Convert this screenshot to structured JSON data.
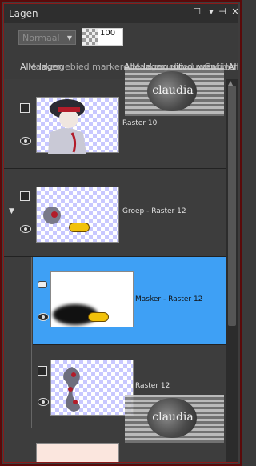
{
  "panel": {
    "title": "Lagen",
    "window_icons": [
      "restore-icon",
      "dropdown-icon",
      "pin-icon",
      "close-icon"
    ]
  },
  "toolbar": {
    "blend_mode": "Normaal",
    "opacity": "100"
  },
  "actions": {
    "overlapping_labels": [
      "Alle lagen",
      "Maskergebied markeren",
      "Alle lagen uitvouwen",
      "Maskergebied verwijderen",
      "Gebied markeren",
      "Alle lagen samenvoegen"
    ]
  },
  "layers": [
    {
      "name": "Raster 10",
      "type": "raster",
      "indent": 0,
      "selected": false
    },
    {
      "name": "Groep - Raster 12",
      "type": "group",
      "indent": 0,
      "selected": false,
      "expanded": true
    },
    {
      "name": "Masker - Raster 12",
      "type": "mask",
      "indent": 1,
      "selected": true
    },
    {
      "name": "Raster 12",
      "type": "raster",
      "indent": 1,
      "selected": false
    },
    {
      "name": "",
      "type": "raster",
      "indent": 0,
      "selected": false
    }
  ],
  "watermark": {
    "text": "claudia"
  },
  "colors": {
    "panel_bg": "#3d3d3d",
    "selected_bg": "#3ea0f5",
    "border_red": "#8a1a1a"
  }
}
